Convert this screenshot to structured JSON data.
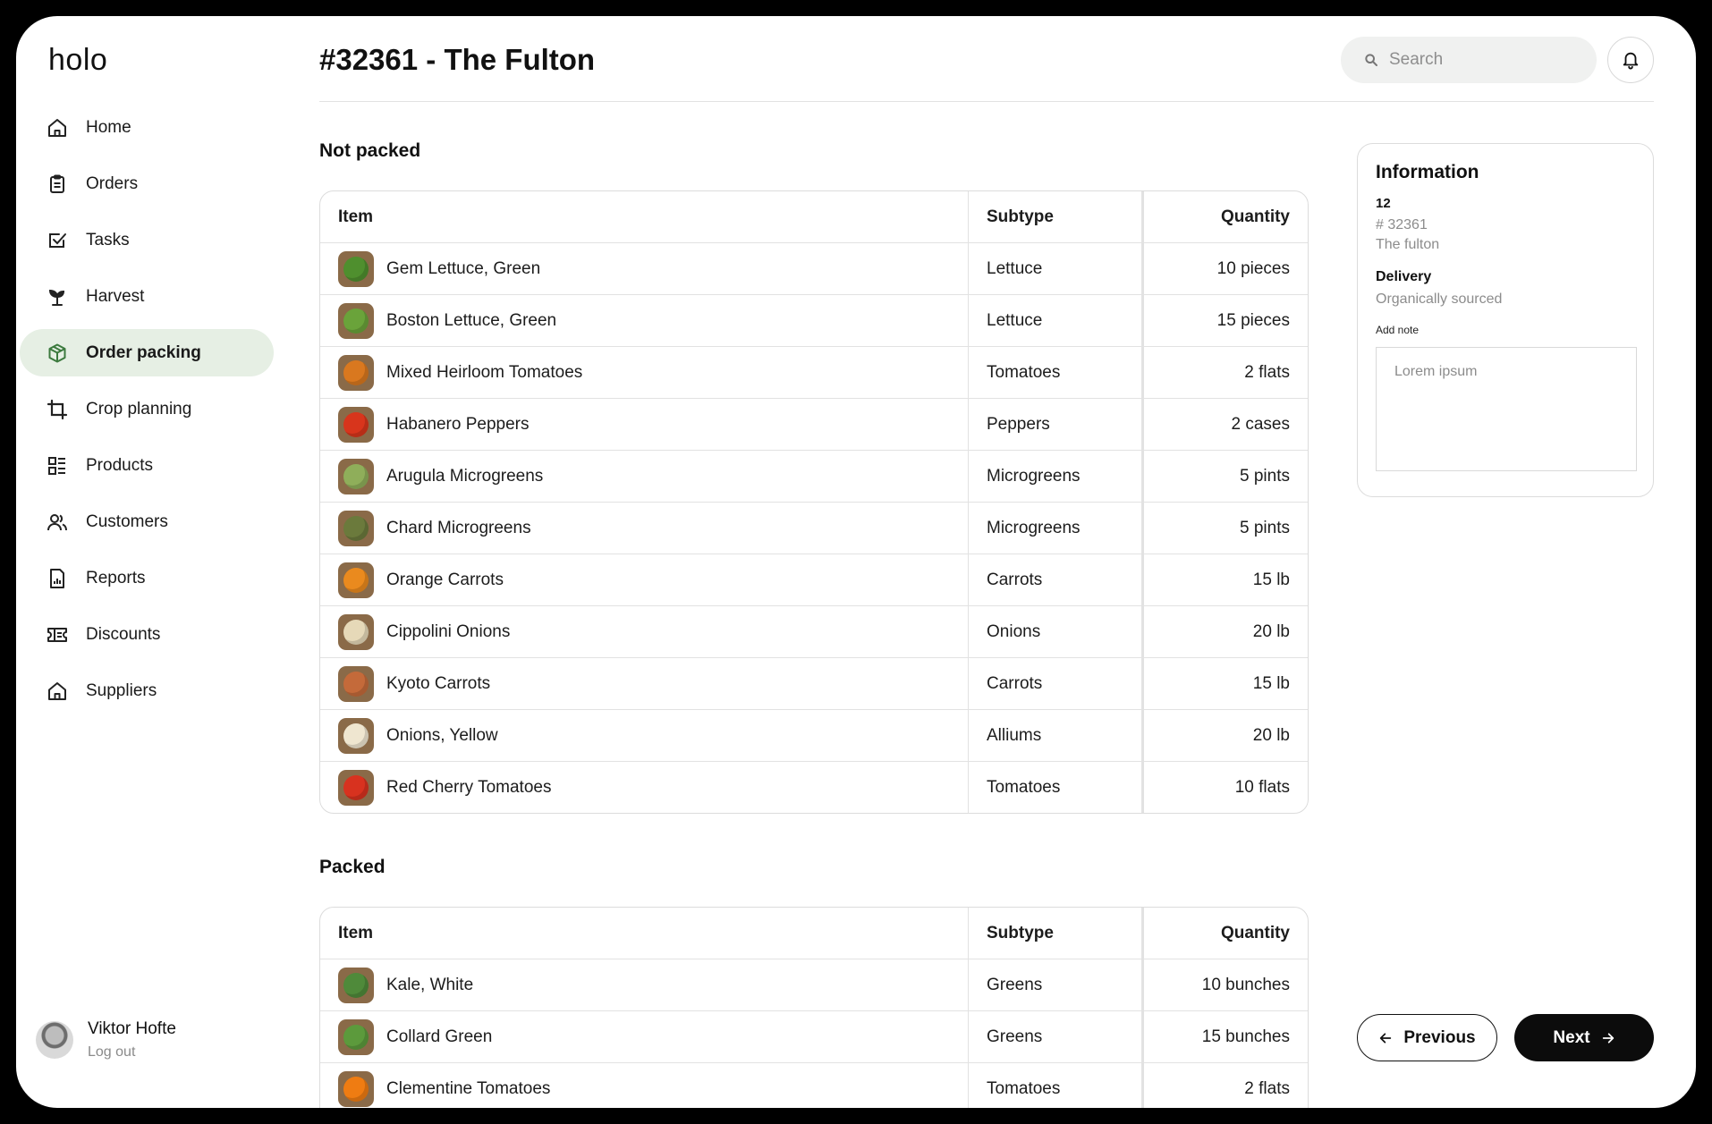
{
  "app": {
    "logo": "holo"
  },
  "sidebar": {
    "items": [
      {
        "label": "Home",
        "icon": "home-icon"
      },
      {
        "label": "Orders",
        "icon": "clipboard-icon"
      },
      {
        "label": "Tasks",
        "icon": "checkbox-icon"
      },
      {
        "label": "Harvest",
        "icon": "sprout-icon"
      },
      {
        "label": "Order packing",
        "icon": "package-icon",
        "active": true
      },
      {
        "label": "Crop planning",
        "icon": "crop-icon"
      },
      {
        "label": "Products",
        "icon": "list-icon"
      },
      {
        "label": "Customers",
        "icon": "users-icon"
      },
      {
        "label": "Reports",
        "icon": "report-icon"
      },
      {
        "label": "Discounts",
        "icon": "ticket-icon"
      },
      {
        "label": "Suppliers",
        "icon": "store-icon"
      }
    ]
  },
  "user": {
    "name": "Viktor Hofte",
    "logout": "Log out"
  },
  "header": {
    "title": "#32361 - The Fulton",
    "search_placeholder": "Search"
  },
  "not_packed": {
    "title": "Not packed",
    "columns": [
      "Item",
      "Subtype",
      "Quantity"
    ],
    "rows": [
      {
        "item": "Gem Lettuce, Green",
        "subtype": "Lettuce",
        "qty": "10 pieces",
        "color": "#4f8f2e"
      },
      {
        "item": "Boston Lettuce, Green",
        "subtype": "Lettuce",
        "qty": "15 pieces",
        "color": "#6aa33a"
      },
      {
        "item": "Mixed Heirloom Tomatoes",
        "subtype": "Tomatoes",
        "qty": "2 flats",
        "color": "#d9781f"
      },
      {
        "item": "Habanero Peppers",
        "subtype": "Peppers",
        "qty": "2 cases",
        "color": "#d8351c"
      },
      {
        "item": "Arugula Microgreens",
        "subtype": "Microgreens",
        "qty": "5 pints",
        "color": "#8fae5a"
      },
      {
        "item": "Chard Microgreens",
        "subtype": "Microgreens",
        "qty": "5 pints",
        "color": "#6b7a3c"
      },
      {
        "item": "Orange Carrots",
        "subtype": "Carrots",
        "qty": "15 lb",
        "color": "#ea8a1e"
      },
      {
        "item": "Cippolini Onions",
        "subtype": "Onions",
        "qty": "20 lb",
        "color": "#e6d9b8"
      },
      {
        "item": "Kyoto Carrots",
        "subtype": "Carrots",
        "qty": "15 lb",
        "color": "#c46a3a"
      },
      {
        "item": "Onions, Yellow",
        "subtype": "Alliums",
        "qty": "20 lb",
        "color": "#efe6d0"
      },
      {
        "item": "Red Cherry Tomatoes",
        "subtype": "Tomatoes",
        "qty": "10 flats",
        "color": "#d8321f"
      }
    ]
  },
  "packed": {
    "title": "Packed",
    "columns": [
      "Item",
      "Subtype",
      "Quantity"
    ],
    "rows": [
      {
        "item": "Kale, White",
        "subtype": "Greens",
        "qty": "10 bunches",
        "color": "#4f8a3a"
      },
      {
        "item": "Collard Green",
        "subtype": "Greens",
        "qty": "15 bunches",
        "color": "#5c9a3c"
      },
      {
        "item": "Clementine Tomatoes",
        "subtype": "Tomatoes",
        "qty": "2 flats",
        "color": "#ef7c12"
      }
    ]
  },
  "information": {
    "title": "Information",
    "count": "12",
    "order_number": "# 32361",
    "customer": "The fulton",
    "delivery_label": "Delivery",
    "delivery_value": "Organically sourced",
    "note_label": "Add note",
    "note_placeholder": "Lorem ipsum"
  },
  "buttons": {
    "previous": "Previous",
    "next": "Next"
  }
}
